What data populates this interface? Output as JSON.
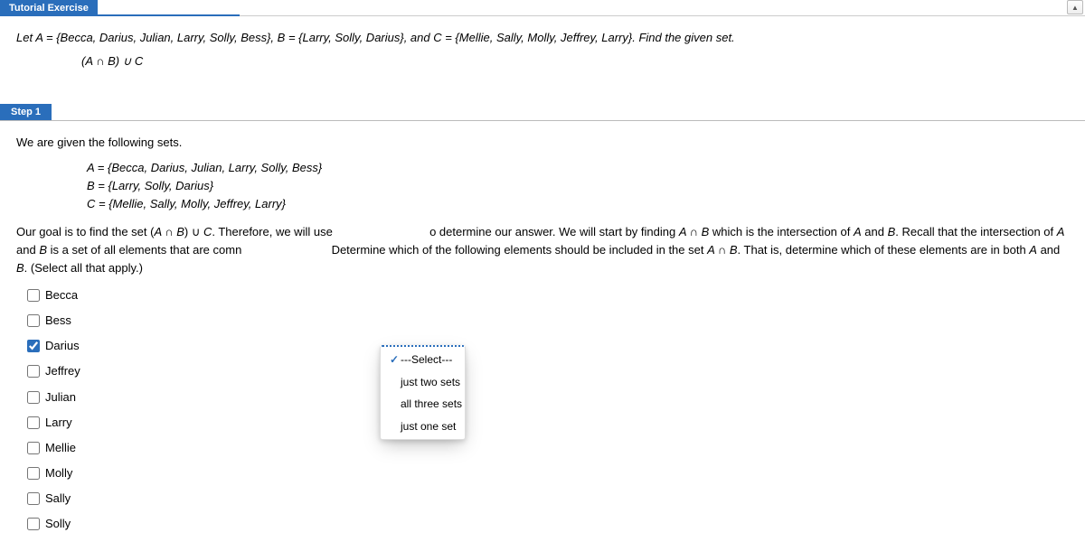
{
  "header": {
    "tutorial_tab": "Tutorial Exercise"
  },
  "problem": {
    "line": "Let A = {Becca, Darius, Julian, Larry, Solly, Bess}, B = {Larry, Solly, Darius}, and C = {Mellie, Sally, Molly, Jeffrey, Larry}. Find the given set.",
    "expr": "(A ∩ B) ∪ C"
  },
  "step1": {
    "tab": "Step 1",
    "intro": "We are given the following sets.",
    "setA": "A = {Becca, Darius, Julian, Larry, Solly, Bess}",
    "setB": "B = {Larry, Solly, Darius}",
    "setC": "C = {Mellie, Sally, Molly, Jeffrey, Larry}",
    "para_a": "Our goal is to find the set (",
    "para_b": ") ∪ ",
    "para_c": ". Therefore, we will use",
    "para_d": "o determine our answer. We will start by finding ",
    "para_e": " which is the intersection of ",
    "para_f": " and ",
    "para_g": ". Recall that the intersection of ",
    "para_h": " is a set of all elements that are comn",
    "para_i": "  Determine which of the following elements should be included in the set ",
    "para_j": ". That is, determine which of these elements are in both ",
    "para_k": ". (Select all that apply.)",
    "A": "A",
    "B": "B",
    "C": "C",
    "AnB": "A ∩ B"
  },
  "dropdown": {
    "opt1": "---Select---",
    "opt2": "just two sets",
    "opt3": "all three sets",
    "opt4": "just one set"
  },
  "choices": {
    "c0": "Becca",
    "c1": "Bess",
    "c2": "Darius",
    "c3": "Jeffrey",
    "c4": "Julian",
    "c5": "Larry",
    "c6": "Mellie",
    "c7": "Molly",
    "c8": "Sally",
    "c9": "Solly"
  }
}
